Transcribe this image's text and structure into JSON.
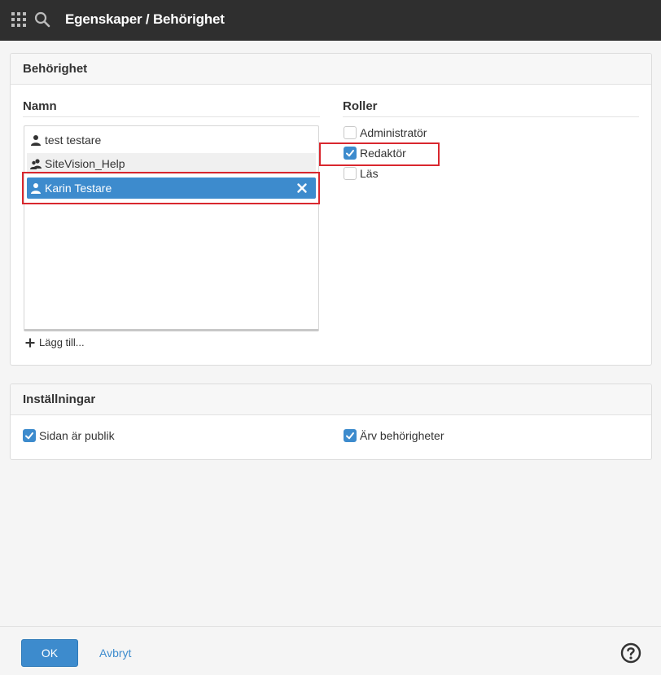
{
  "header": {
    "title": "Egenskaper / Behörighet",
    "icons": [
      "apps-grid-icon",
      "search-icon"
    ]
  },
  "permissions": {
    "panel_title": "Behörighet",
    "names_heading": "Namn",
    "roles_heading": "Roller",
    "names": [
      {
        "label": "test testare",
        "icon": "user-icon",
        "selected": false
      },
      {
        "label": "SiteVision_Help",
        "icon": "user-group-icon",
        "selected": false
      },
      {
        "label": "Karin Testare",
        "icon": "user-icon",
        "selected": true
      }
    ],
    "add_label": "Lägg till...",
    "roles": [
      {
        "label": "Administratör",
        "checked": false
      },
      {
        "label": "Redaktör",
        "checked": true
      },
      {
        "label": "Läs",
        "checked": false
      }
    ]
  },
  "settings": {
    "panel_title": "Inställningar",
    "public_label": "Sidan är publik",
    "public_checked": true,
    "inherit_label": "Ärv behörigheter",
    "inherit_checked": true
  },
  "footer": {
    "ok_label": "OK",
    "cancel_label": "Avbryt"
  },
  "colors": {
    "accent": "#3d8bcd",
    "topbar": "#2f2f2f",
    "highlight": "#d9272e"
  }
}
